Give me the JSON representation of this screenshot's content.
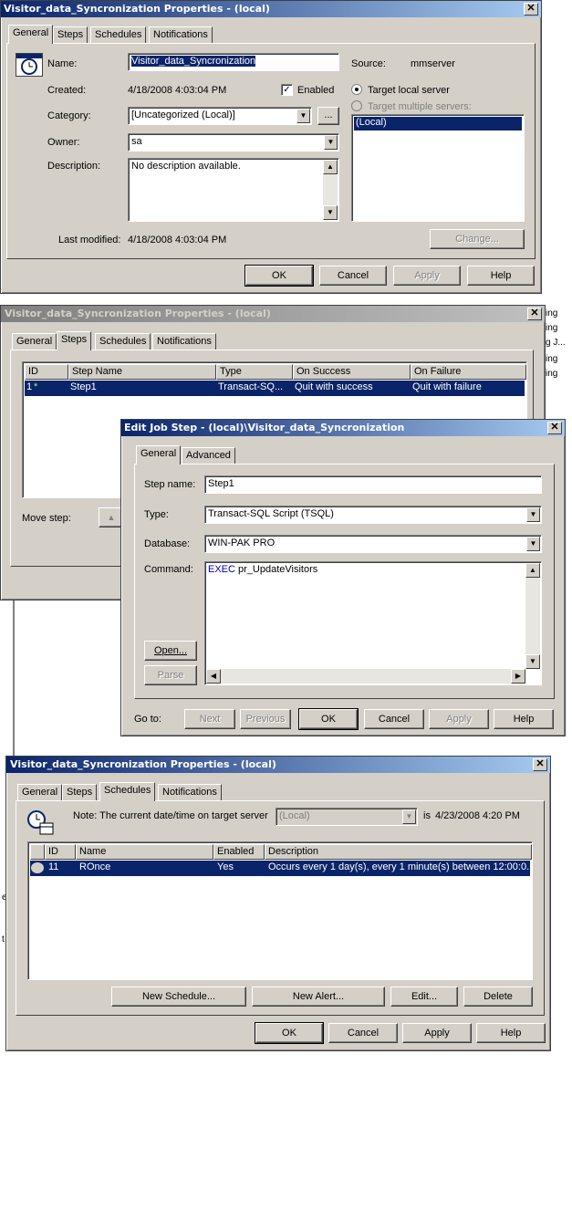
{
  "dialog1": {
    "title": "Visitor_data_Syncronization Properties - (local)",
    "close_glyph": "✕",
    "tabs": [
      "General",
      "Steps",
      "Schedules",
      "Notifications"
    ],
    "name_label": "Name:",
    "name_value": "Visitor_data_Syncronization",
    "source_label": "Source:",
    "source_value": "mmserver",
    "created_label": "Created:",
    "created_value": "4/18/2008 4:03:04 PM",
    "enabled_label": "Enabled",
    "target_local": "Target local server",
    "target_multiple": "Target multiple servers:",
    "servers": [
      "(Local)"
    ],
    "category_label": "Category:",
    "category_value": "[Uncategorized (Local)]",
    "browse_label": "...",
    "owner_label": "Owner:",
    "owner_value": "sa",
    "description_label": "Description:",
    "description_value": "No description available.",
    "last_modified_label": "Last modified:",
    "last_modified_value": "4/18/2008 4:03:04 PM",
    "change_button": "Change...",
    "buttons": {
      "ok": "OK",
      "cancel": "Cancel",
      "apply": "Apply",
      "help": "Help"
    }
  },
  "dialog2": {
    "title": "Visitor_data_Syncronization Properties - (local)",
    "close_glyph": "✕",
    "tabs": [
      "General",
      "Steps",
      "Schedules",
      "Notifications"
    ],
    "columns": [
      "ID",
      "Step Name",
      "Type",
      "On Success",
      "On Failure"
    ],
    "rows": [
      {
        "id": "1",
        "mark": "*",
        "name": "Step1",
        "type": "Transact-SQ...",
        "on_success": "Quit with success",
        "on_failure": "Quit with failure"
      }
    ],
    "move_step_label": "Move step:",
    "up_glyph": "▲",
    "bg_fragments": [
      "ing",
      "ing",
      "g J...",
      "ing",
      "ing"
    ]
  },
  "edit_step": {
    "title": "Edit Job Step - (local)\\Visitor_data_Syncronization",
    "close_glyph": "✕",
    "tabs": [
      "General",
      "Advanced"
    ],
    "step_name_label": "Step name:",
    "step_name_value": "Step1",
    "type_label": "Type:",
    "type_value": "Transact-SQL Script (TSQL)",
    "database_label": "Database:",
    "database_value": "WIN-PAK PRO",
    "command_label": "Command:",
    "command_keyword": "EXEC",
    "command_rest": " pr_UpdateVisitors",
    "open_button": "Open...",
    "parse_button": "Parse",
    "goto_label": "Go to:",
    "buttons": {
      "next": "Next",
      "previous": "Previous",
      "ok": "OK",
      "cancel": "Cancel",
      "apply": "Apply",
      "help": "Help"
    }
  },
  "dialog3": {
    "title": "Visitor_data_Syncronization Properties - (local)",
    "close_glyph": "✕",
    "tabs": [
      "General",
      "Steps",
      "Schedules",
      "Notifications"
    ],
    "note_label": "Note: The current date/time on target server",
    "server_value": "(Local)",
    "is_label": "is",
    "datetime_value": "4/23/2008 4:20 PM",
    "columns": [
      "ID",
      "Name",
      "Enabled",
      "Description"
    ],
    "rows": [
      {
        "id": "11",
        "name": "ROnce",
        "enabled": "Yes",
        "description": "Occurs every 1 day(s), every 1 minute(s) between 12:00:0..."
      }
    ],
    "new_schedule": "New Schedule...",
    "new_alert": "New Alert...",
    "edit": "Edit...",
    "delete": "Delete",
    "buttons": {
      "ok": "OK",
      "cancel": "Cancel",
      "apply": "Apply",
      "help": "Help"
    },
    "bg_fragments": [
      "e",
      "t"
    ]
  },
  "colors": {
    "title_active": "#0a246a",
    "title_inactive": "#808080",
    "face": "#d4d0c8",
    "highlight": "#0a246a"
  }
}
